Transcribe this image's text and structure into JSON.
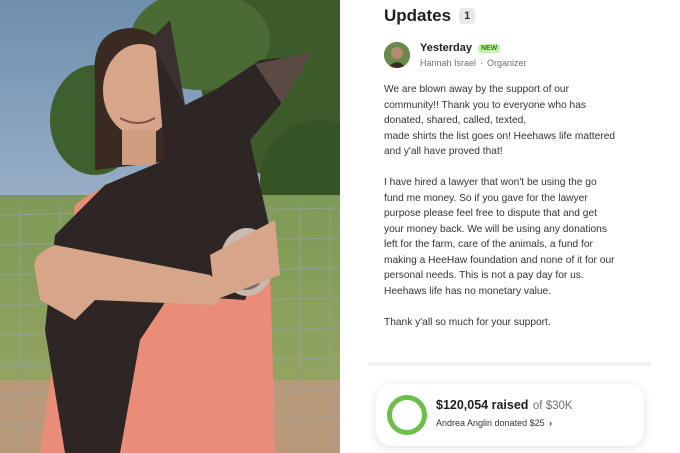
{
  "updates": {
    "title": "Updates",
    "count": "1"
  },
  "update": {
    "day": "Yesterday",
    "badge": "NEW",
    "author": "Hannah Israel",
    "role": "Organizer",
    "paragraphs": [
      "We are blown away by the support of our\ncommunity!! Thank you to everyone who has\ndonated, shared, called, texted,\nmade shirts the list goes on! Heehaws life mattered\nand y'all have proved that!",
      "I have hired a lawyer that won't be using the go\nfund me money. So if you gave for the lawyer\npurpose please feel free to dispute that and get\nyour money back. We will be using any donations\nleft for the farm, care of the animals, a fund for\nmaking a HeeHaw foundation and none of it for our\npersonal needs. This is not a pay day for us.\nHeehaws life has no monetary value.",
      "Thank y'all so much for your support."
    ]
  },
  "donation": {
    "raised": "$120,054 raised",
    "goal": "of $30K",
    "progress": 1.0,
    "recent": "Andrea Anglin donated $25",
    "chevron": "›"
  },
  "colors": {
    "progress": "#6cc04a",
    "new_badge_bg": "#c8f2a8",
    "new_badge_text": "#2f7d1c"
  },
  "icons": {
    "photo": "girl-holding-donkey-photo",
    "avatar": "organizer-avatar"
  }
}
